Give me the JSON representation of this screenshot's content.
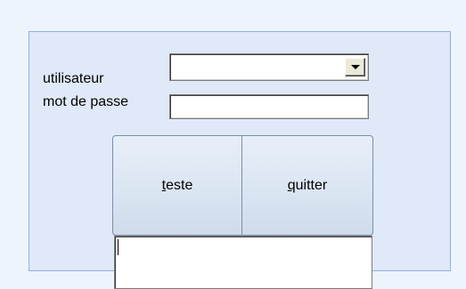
{
  "form": {
    "user_label": "utilisateur",
    "password_label": "mot de passe",
    "user_value": "",
    "password_value": ""
  },
  "buttons": {
    "test_mnemonic": "t",
    "test_rest": "este",
    "quit_mnemonic": "q",
    "quit_rest": "uitter"
  },
  "memo": {
    "text": ""
  },
  "icons": {
    "combo_arrow": "dropdown-arrow-icon"
  }
}
